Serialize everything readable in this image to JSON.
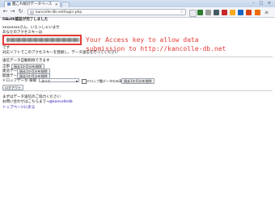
{
  "browser": {
    "tab_title": "艦これ統計データベース",
    "tab_close": "×",
    "url": "kancolle-db.net/login.php",
    "window_controls": "– □ ×"
  },
  "page": {
    "heading": "OAuth認証が完了しました",
    "greeting": "xxxxxxxxさん、いらっしゃいませ",
    "key_label": "あなたのアクセスキーは",
    "annotation_line1": "Your Access key to allow data",
    "annotation_line2": "submission to http://kancolle-db.net",
    "desu": "です",
    "tool_note": "対応ソフトでこのアクセスキーを登録し、データ送信を行ってください",
    "auto_delete_label": "送信データ自動削除できます",
    "rows": [
      {
        "label": "全部",
        "button": "過去1か月分を削除"
      },
      {
        "label": "建造データ",
        "button": "過去1か月分を削除"
      },
      {
        "label": "開発データ",
        "button": "過去1か月分を削除"
      }
    ],
    "drop_label": "ドロップデータ 海域",
    "drop_select": "すべて",
    "drop_check_label": "ドロップ艦データのみ表示",
    "drop_button": "過去1か月分を削除",
    "logout_button": "ログアウト",
    "footer_line1": "まずはデータ送信のご協力ください",
    "footer_line2": "お問い合わせはこちらまで→",
    "footer_contact": "@kancolledb",
    "footer_top_link": "トップページに戻る"
  },
  "colors": {
    "highlight": "#e53935",
    "link": "#1a0dab"
  }
}
